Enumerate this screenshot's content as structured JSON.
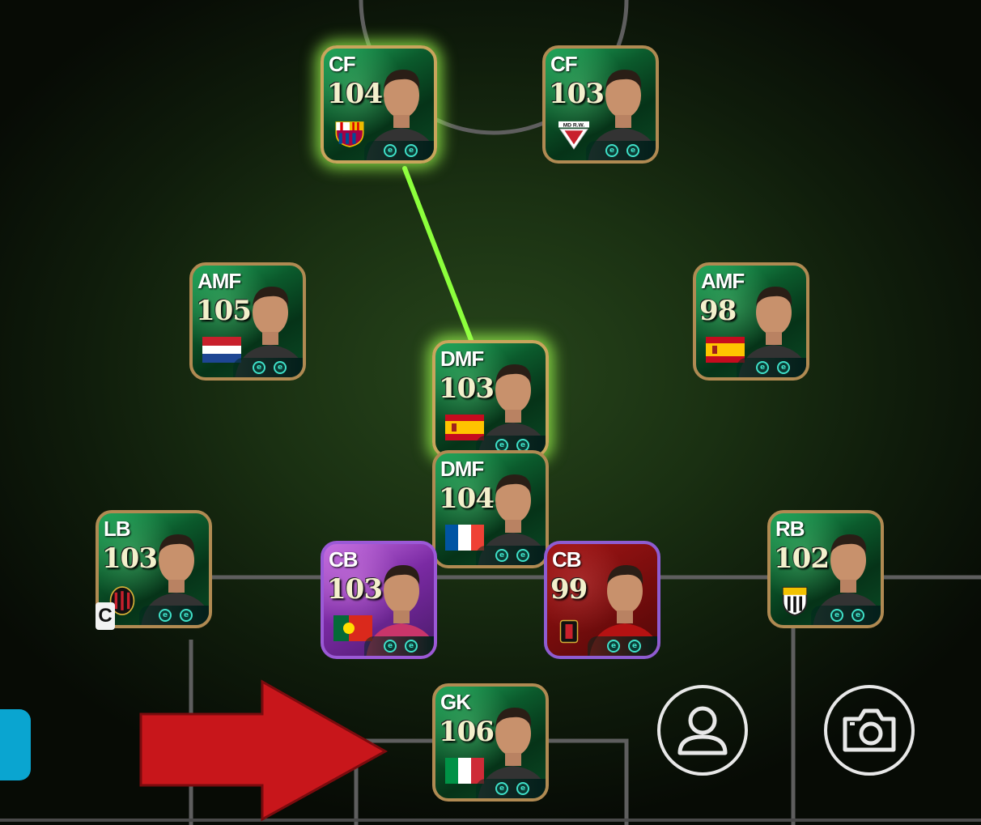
{
  "formation": {
    "players": [
      {
        "id": "cf-left",
        "position": "CF",
        "rating": "104",
        "badge": "fc-barcelona-crest",
        "linked": true,
        "style": "green"
      },
      {
        "id": "cf-right",
        "position": "CF",
        "rating": "103",
        "badge": "md-rw-crest",
        "badge_text": "MD R.W.",
        "linked": false,
        "style": "green"
      },
      {
        "id": "amf-left",
        "position": "AMF",
        "rating": "105",
        "badge": "netherlands-flag",
        "linked": false,
        "style": "green"
      },
      {
        "id": "amf-right",
        "position": "AMF",
        "rating": "98",
        "badge": "spain-flag",
        "linked": false,
        "style": "green"
      },
      {
        "id": "dmf-top",
        "position": "DMF",
        "rating": "103",
        "badge": "spain-flag",
        "linked": true,
        "style": "green"
      },
      {
        "id": "dmf-bottom",
        "position": "DMF",
        "rating": "104",
        "badge": "france-flag",
        "linked": false,
        "style": "green"
      },
      {
        "id": "lb",
        "position": "LB",
        "rating": "103",
        "badge": "ac-milan-crest",
        "linked": false,
        "style": "green",
        "captain": true
      },
      {
        "id": "cb-left",
        "position": "CB",
        "rating": "103",
        "badge": "portugal-flag",
        "linked": false,
        "style": "purple"
      },
      {
        "id": "cb-right",
        "position": "CB",
        "rating": "99",
        "badge": "club-crest",
        "linked": false,
        "style": "red"
      },
      {
        "id": "rb",
        "position": "RB",
        "rating": "102",
        "badge": "club-crest-striped",
        "linked": false,
        "style": "green"
      },
      {
        "id": "gk",
        "position": "GK",
        "rating": "106",
        "badge": "italy-flag",
        "linked": false,
        "style": "green"
      }
    ],
    "captain_label": "C"
  },
  "controls": {
    "player_button_icon": "person-icon",
    "camera_button_icon": "camera-icon",
    "side_tab_color": "#0aa5d0"
  },
  "annotation": {
    "arrow_color": "#c8161b",
    "arrow_direction": "right"
  },
  "colors": {
    "link_line": "#8cff3c",
    "card_border": "#b08a52",
    "pitch_lines": "#5e5e5e"
  }
}
